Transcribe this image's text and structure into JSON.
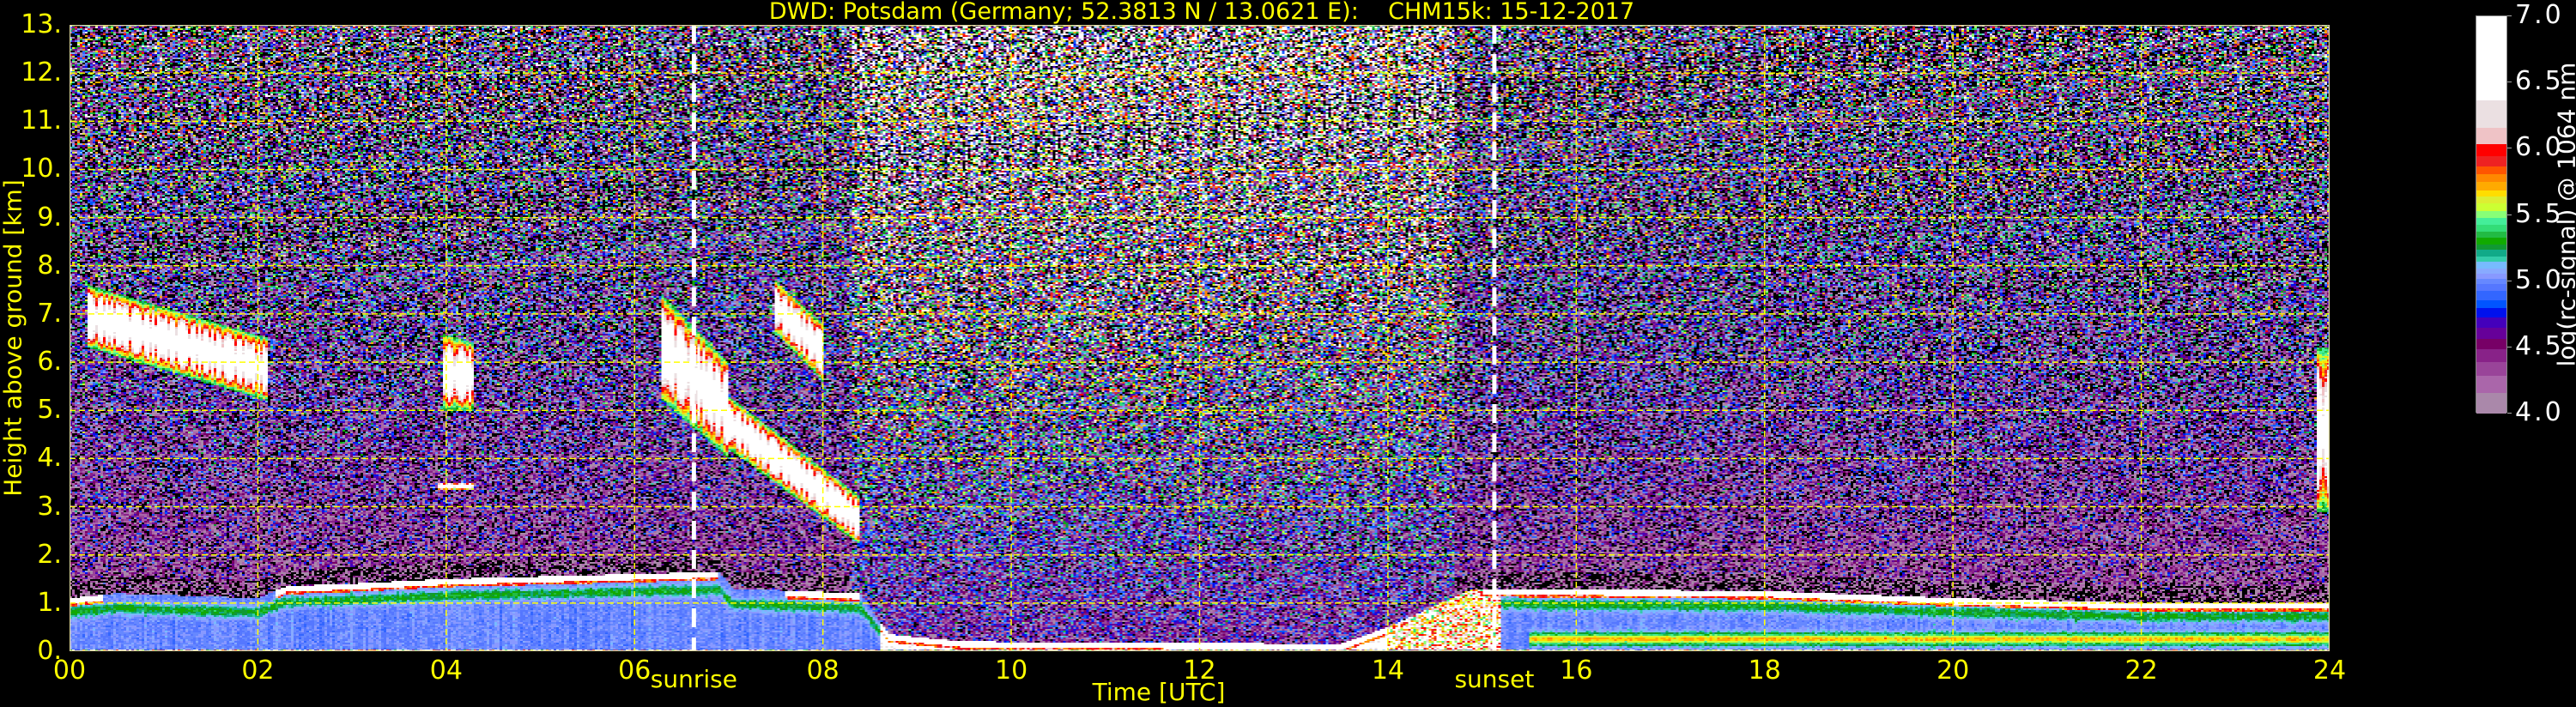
{
  "chart_data": {
    "type": "heatmap",
    "title": "DWD: Potsdam (Germany; 52.3813 N / 13.0621 E):    CHM15k: 15-12-2017",
    "xlabel": "Time [UTC]",
    "ylabel": "Height above ground [km]",
    "xlim": [
      0,
      24
    ],
    "ylim": [
      0,
      13
    ],
    "x_ticks": [
      0,
      2,
      4,
      6,
      8,
      10,
      12,
      14,
      16,
      18,
      20,
      22,
      24
    ],
    "x_tick_labels": [
      "00",
      "02",
      "04",
      "06",
      "08",
      "10",
      "12",
      "14",
      "16",
      "18",
      "20",
      "22",
      "24"
    ],
    "y_ticks": [
      0,
      1,
      2,
      3,
      4,
      5,
      6,
      7,
      8,
      9,
      10,
      11,
      12,
      13
    ],
    "y_tick_labels": [
      "0.",
      "1.",
      "2.",
      "3.",
      "4.",
      "5.",
      "6.",
      "7.",
      "8.",
      "9.",
      "10.",
      "11.",
      "12.",
      "13."
    ],
    "grid": true,
    "grid_color": "#ffff00",
    "events": [
      {
        "label": "sunrise",
        "time": 6.63,
        "color": "#ffffff"
      },
      {
        "label": "sunset",
        "time": 15.13,
        "color": "#ffffff"
      }
    ],
    "colorbar": {
      "label": "log(rc-signal) @ 1064 nm",
      "range": [
        4.0,
        7.0
      ],
      "ticks": [
        7.0,
        6.5,
        6.0,
        5.5,
        5.0,
        4.5,
        4.0
      ],
      "tick_labels": [
        "7.0",
        "6.5",
        "6.0",
        "5.5",
        "5.0",
        "4.5",
        "4.0"
      ],
      "below_color": "#000000",
      "levels": [
        4.0,
        4.16,
        4.29,
        4.39,
        4.49,
        4.57,
        4.65,
        4.73,
        4.8,
        4.86,
        4.93,
        4.98,
        5.02,
        5.06,
        5.1,
        5.15,
        5.19,
        5.24,
        5.28,
        5.33,
        5.38,
        5.43,
        5.48,
        5.53,
        5.59,
        5.64,
        5.69,
        5.75,
        5.81,
        5.87,
        5.95,
        6.04,
        6.16,
        6.37,
        7.0
      ],
      "colors": [
        "#aa88aa",
        "#aa66aa",
        "#994499",
        "#882288",
        "#770066",
        "#660099",
        "#4400bb",
        "#0011ee",
        "#0055ff",
        "#3366ff",
        "#5577ff",
        "#6688ff",
        "#8899ff",
        "#88aaff",
        "#77bbff",
        "#33ccaa",
        "#11aa88",
        "#119933",
        "#11aa00",
        "#22bb44",
        "#33dd77",
        "#44ee99",
        "#88ff77",
        "#ccff33",
        "#ddee33",
        "#ffdd00",
        "#ffaa00",
        "#ff8800",
        "#ff5500",
        "#ee2222",
        "#ff0000",
        "#efc3c6",
        "#ebe0e2",
        "#ffffff"
      ]
    },
    "boundary_layer_top_km": [
      [
        0,
        1.1
      ],
      [
        0.5,
        1.2
      ],
      [
        2,
        1.1
      ],
      [
        2.3,
        1.35
      ],
      [
        3,
        1.4
      ],
      [
        4,
        1.5
      ],
      [
        5,
        1.55
      ],
      [
        6,
        1.6
      ],
      [
        6.9,
        1.65
      ],
      [
        7.05,
        1.3
      ],
      [
        8.4,
        1.2
      ],
      [
        8.7,
        0.35
      ],
      [
        9.5,
        0.2
      ],
      [
        13.5,
        0.15
      ],
      [
        14,
        0.5
      ],
      [
        14.9,
        1.3
      ],
      [
        18,
        1.25
      ],
      [
        20,
        1.1
      ],
      [
        22,
        1.0
      ],
      [
        24,
        1.0
      ]
    ],
    "cloud_layers": [
      {
        "time": [
          0.2,
          2.1
        ],
        "base_km": [
          6.3,
          5.2
        ],
        "top_km": [
          7.6,
          6.5
        ]
      },
      {
        "time": [
          3.95,
          4.3
        ],
        "base_km": [
          5.0,
          5.0
        ],
        "top_km": [
          6.6,
          6.4
        ]
      },
      {
        "time": [
          6.3,
          7.0
        ],
        "base_km": [
          5.2,
          4.0
        ],
        "top_km": [
          7.4,
          6.0
        ]
      },
      {
        "time": [
          7.0,
          8.4
        ],
        "base_km": [
          4.2,
          2.2
        ],
        "top_km": [
          5.3,
          3.2
        ]
      },
      {
        "time": [
          7.5,
          8.0
        ],
        "base_km": [
          6.6,
          5.6
        ],
        "top_km": [
          7.7,
          6.8
        ]
      },
      {
        "time": [
          3.9,
          4.3
        ],
        "base_km": [
          3.35,
          3.35
        ],
        "top_km": [
          3.5,
          3.5
        ]
      },
      {
        "time": [
          23.85,
          24
        ],
        "base_km": [
          2.9,
          2.9
        ],
        "top_km": [
          6.3,
          6.3
        ]
      }
    ]
  }
}
